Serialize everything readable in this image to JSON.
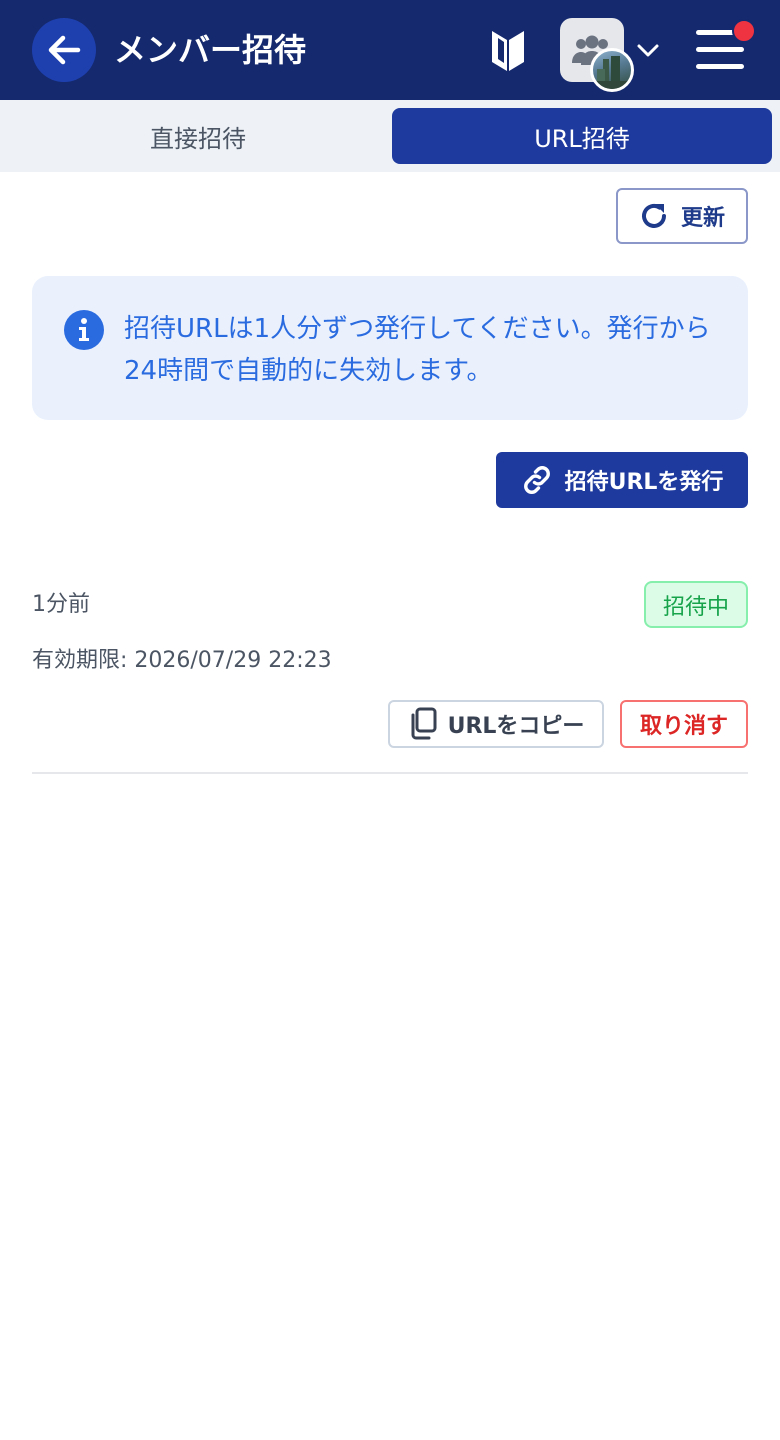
{
  "header": {
    "title": "メンバー招待",
    "bg_color": "#14296e",
    "notification_dot_color": "#ef3340",
    "icons": [
      "back-arrow-icon",
      "beginner-mark-icon",
      "team-icon",
      "chevron-down-icon",
      "hamburger-menu-icon"
    ]
  },
  "tabs": [
    {
      "label": "直接招待",
      "active": false
    },
    {
      "label": "URL招待",
      "active": true
    }
  ],
  "actions": {
    "refresh_label": "更新",
    "issue_label": "招待URLを発行"
  },
  "info": {
    "text": "招待URLは1人分ずつ発行してください。発行から24時間で自動的に失効します。",
    "color": "#2a6be0"
  },
  "invites": [
    {
      "elapsed": "1分前",
      "status": "招待中",
      "expiry": "有効期限: 2026/07/29 22:23",
      "copy_label": "URLをコピー",
      "revoke_label": "取り消す"
    }
  ]
}
